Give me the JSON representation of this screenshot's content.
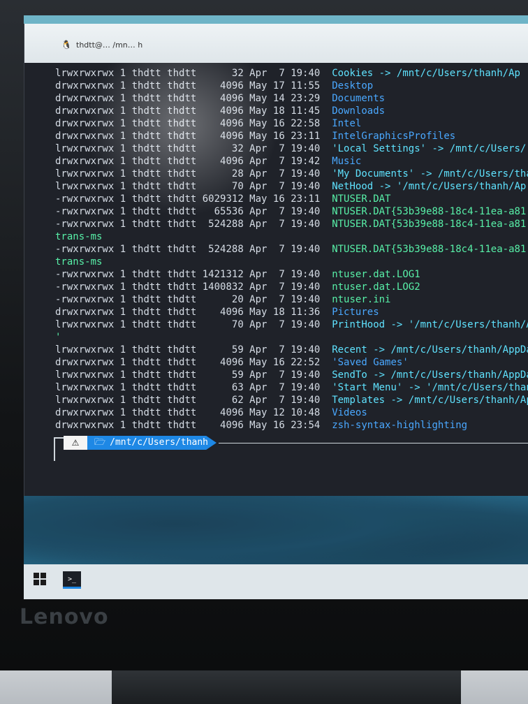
{
  "window": {
    "tab_title": "thdtt@… /mn… h"
  },
  "lines": [
    {
      "perm": "lrwxrwxrwx",
      "links": "1",
      "owner": "thdtt",
      "group": "thdtt",
      "size": "32",
      "month": "Apr",
      "day": "7",
      "time": "19:40",
      "name": "Cookies -> /mnt/c/Users/thanh/Ap",
      "kind": "link"
    },
    {
      "perm": "drwxrwxrwx",
      "links": "1",
      "owner": "thdtt",
      "group": "thdtt",
      "size": "4096",
      "month": "May",
      "day": "17",
      "time": "11:55",
      "name": "Desktop",
      "kind": "dir"
    },
    {
      "perm": "drwxrwxrwx",
      "links": "1",
      "owner": "thdtt",
      "group": "thdtt",
      "size": "4096",
      "month": "May",
      "day": "14",
      "time": "23:29",
      "name": "Documents",
      "kind": "dir"
    },
    {
      "perm": "drwxrwxrwx",
      "links": "1",
      "owner": "thdtt",
      "group": "thdtt",
      "size": "4096",
      "month": "May",
      "day": "18",
      "time": "11:45",
      "name": "Downloads",
      "kind": "dir"
    },
    {
      "perm": "drwxrwxrwx",
      "links": "1",
      "owner": "thdtt",
      "group": "thdtt",
      "size": "4096",
      "month": "May",
      "day": "16",
      "time": "22:58",
      "name": "Intel",
      "kind": "dir"
    },
    {
      "perm": "drwxrwxrwx",
      "links": "1",
      "owner": "thdtt",
      "group": "thdtt",
      "size": "4096",
      "month": "May",
      "day": "16",
      "time": "23:11",
      "name": "IntelGraphicsProfiles",
      "kind": "dir"
    },
    {
      "perm": "lrwxrwxrwx",
      "links": "1",
      "owner": "thdtt",
      "group": "thdtt",
      "size": "32",
      "month": "Apr",
      "day": "7",
      "time": "19:40",
      "name": "'Local Settings' -> /mnt/c/Users/",
      "kind": "link"
    },
    {
      "perm": "drwxrwxrwx",
      "links": "1",
      "owner": "thdtt",
      "group": "thdtt",
      "size": "4096",
      "month": "Apr",
      "day": "7",
      "time": "19:42",
      "name": "Music",
      "kind": "dir"
    },
    {
      "perm": "lrwxrwxrwx",
      "links": "1",
      "owner": "thdtt",
      "group": "thdtt",
      "size": "28",
      "month": "Apr",
      "day": "7",
      "time": "19:40",
      "name": "'My Documents' -> /mnt/c/Users/tha",
      "kind": "link"
    },
    {
      "perm": "lrwxrwxrwx",
      "links": "1",
      "owner": "thdtt",
      "group": "thdtt",
      "size": "70",
      "month": "Apr",
      "day": "7",
      "time": "19:40",
      "name": "NetHood -> '/mnt/c/Users/thanh/Ap",
      "kind": "link"
    },
    {
      "perm": "-rwxrwxrwx",
      "links": "1",
      "owner": "thdtt",
      "group": "thdtt",
      "size": "6029312",
      "month": "May",
      "day": "16",
      "time": "23:11",
      "name": "NTUSER.DAT",
      "kind": "file"
    },
    {
      "perm": "-rwxrwxrwx",
      "links": "1",
      "owner": "thdtt",
      "group": "thdtt",
      "size": "65536",
      "month": "Apr",
      "day": "7",
      "time": "19:40",
      "name": "NTUSER.DAT{53b39e88-18c4-11ea-a81",
      "kind": "file"
    },
    {
      "perm": "-rwxrwxrwx",
      "links": "1",
      "owner": "thdtt",
      "group": "thdtt",
      "size": "524288",
      "month": "Apr",
      "day": "7",
      "time": "19:40",
      "name": "NTUSER.DAT{53b39e88-18c4-11ea-a81",
      "kind": "file"
    },
    {
      "wrap": "trans-ms"
    },
    {
      "perm": "-rwxrwxrwx",
      "links": "1",
      "owner": "thdtt",
      "group": "thdtt",
      "size": "524288",
      "month": "Apr",
      "day": "7",
      "time": "19:40",
      "name": "NTUSER.DAT{53b39e88-18c4-11ea-a81",
      "kind": "file"
    },
    {
      "wrap": "trans-ms"
    },
    {
      "perm": "-rwxrwxrwx",
      "links": "1",
      "owner": "thdtt",
      "group": "thdtt",
      "size": "1421312",
      "month": "Apr",
      "day": "7",
      "time": "19:40",
      "name": "ntuser.dat.LOG1",
      "kind": "file"
    },
    {
      "perm": "-rwxrwxrwx",
      "links": "1",
      "owner": "thdtt",
      "group": "thdtt",
      "size": "1400832",
      "month": "Apr",
      "day": "7",
      "time": "19:40",
      "name": "ntuser.dat.LOG2",
      "kind": "file"
    },
    {
      "perm": "-rwxrwxrwx",
      "links": "1",
      "owner": "thdtt",
      "group": "thdtt",
      "size": "20",
      "month": "Apr",
      "day": "7",
      "time": "19:40",
      "name": "ntuser.ini",
      "kind": "file"
    },
    {
      "perm": "drwxrwxrwx",
      "links": "1",
      "owner": "thdtt",
      "group": "thdtt",
      "size": "4096",
      "month": "May",
      "day": "18",
      "time": "11:36",
      "name": "Pictures",
      "kind": "dir"
    },
    {
      "perm": "lrwxrwxrwx",
      "links": "1",
      "owner": "thdtt",
      "group": "thdtt",
      "size": "70",
      "month": "Apr",
      "day": "7",
      "time": "19:40",
      "name": "PrintHood -> '/mnt/c/Users/thanh/A",
      "kind": "link"
    },
    {
      "wrap": "'"
    },
    {
      "perm": "lrwxrwxrwx",
      "links": "1",
      "owner": "thdtt",
      "group": "thdtt",
      "size": "59",
      "month": "Apr",
      "day": "7",
      "time": "19:40",
      "name": "Recent -> /mnt/c/Users/thanh/AppDa",
      "kind": "link"
    },
    {
      "perm": "drwxrwxrwx",
      "links": "1",
      "owner": "thdtt",
      "group": "thdtt",
      "size": "4096",
      "month": "May",
      "day": "16",
      "time": "22:52",
      "name": "'Saved Games'",
      "kind": "dir"
    },
    {
      "perm": "lrwxrwxrwx",
      "links": "1",
      "owner": "thdtt",
      "group": "thdtt",
      "size": "59",
      "month": "Apr",
      "day": "7",
      "time": "19:40",
      "name": "SendTo -> /mnt/c/Users/thanh/AppDa",
      "kind": "link"
    },
    {
      "perm": "lrwxrwxrwx",
      "links": "1",
      "owner": "thdtt",
      "group": "thdtt",
      "size": "63",
      "month": "Apr",
      "day": "7",
      "time": "19:40",
      "name": "'Start Menu' -> '/mnt/c/Users/thanh/",
      "kind": "link"
    },
    {
      "perm": "lrwxrwxrwx",
      "links": "1",
      "owner": "thdtt",
      "group": "thdtt",
      "size": "62",
      "month": "Apr",
      "day": "7",
      "time": "19:40",
      "name": "Templates -> /mnt/c/Users/thanh/App",
      "kind": "link"
    },
    {
      "perm": "drwxrwxrwx",
      "links": "1",
      "owner": "thdtt",
      "group": "thdtt",
      "size": "4096",
      "month": "May",
      "day": "12",
      "time": "10:48",
      "name": "Videos",
      "kind": "dir"
    },
    {
      "perm": "drwxrwxrwx",
      "links": "1",
      "owner": "thdtt",
      "group": "thdtt",
      "size": "4096",
      "month": "May",
      "day": "16",
      "time": "23:54",
      "name": "zsh-syntax-highlighting",
      "kind": "dir"
    }
  ],
  "prompt": {
    "warning_icon": "warning-icon",
    "folder_icon": "folder-icon",
    "path": "/mnt/c/Users/thanh"
  },
  "taskbar": {
    "start_icon": "windows-start-icon",
    "terminal_icon": "terminal-icon"
  },
  "brand": {
    "logo": "Lenovo"
  },
  "colors": {
    "dir": "#4aa8ff",
    "link": "#5fe3ff",
    "file": "#58f0a8",
    "prompt_path_bg": "#1e88e5"
  }
}
